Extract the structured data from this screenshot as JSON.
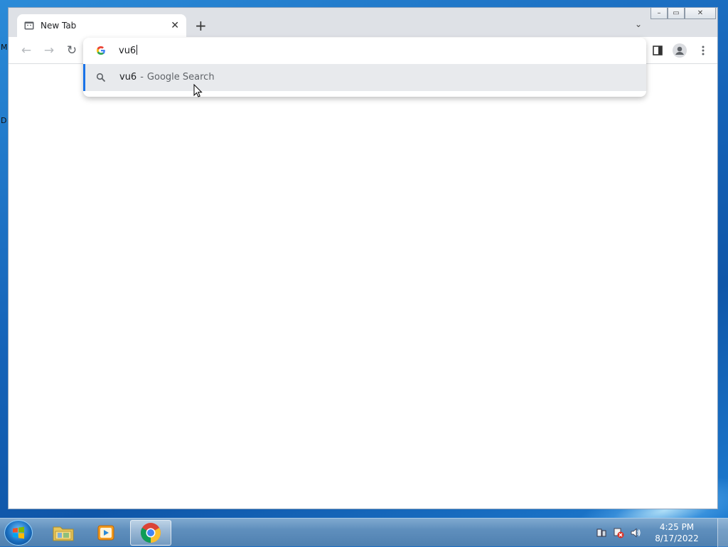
{
  "desktop": {
    "label_m": "M",
    "label_d": "D"
  },
  "browser": {
    "tab": {
      "title": "New Tab",
      "close": "✕"
    },
    "new_tab": "+",
    "tab_search": "⌄",
    "window_controls": {
      "minimize": "–",
      "maximize": "▭",
      "close": "✕"
    },
    "nav": {
      "back": "←",
      "forward": "→",
      "reload": "↻"
    },
    "omnibox": {
      "value": "vu6",
      "suggestions": [
        {
          "query": "vu6",
          "separator": "-",
          "description": "Google Search"
        }
      ]
    }
  },
  "taskbar": {
    "items": [
      "file-explorer",
      "media-player",
      "chrome"
    ],
    "clock": {
      "time": "4:25 PM",
      "date": "8/17/2022"
    }
  },
  "colors": {
    "accent": "#1a73e8",
    "suggestion_bg": "#e8eaed"
  }
}
